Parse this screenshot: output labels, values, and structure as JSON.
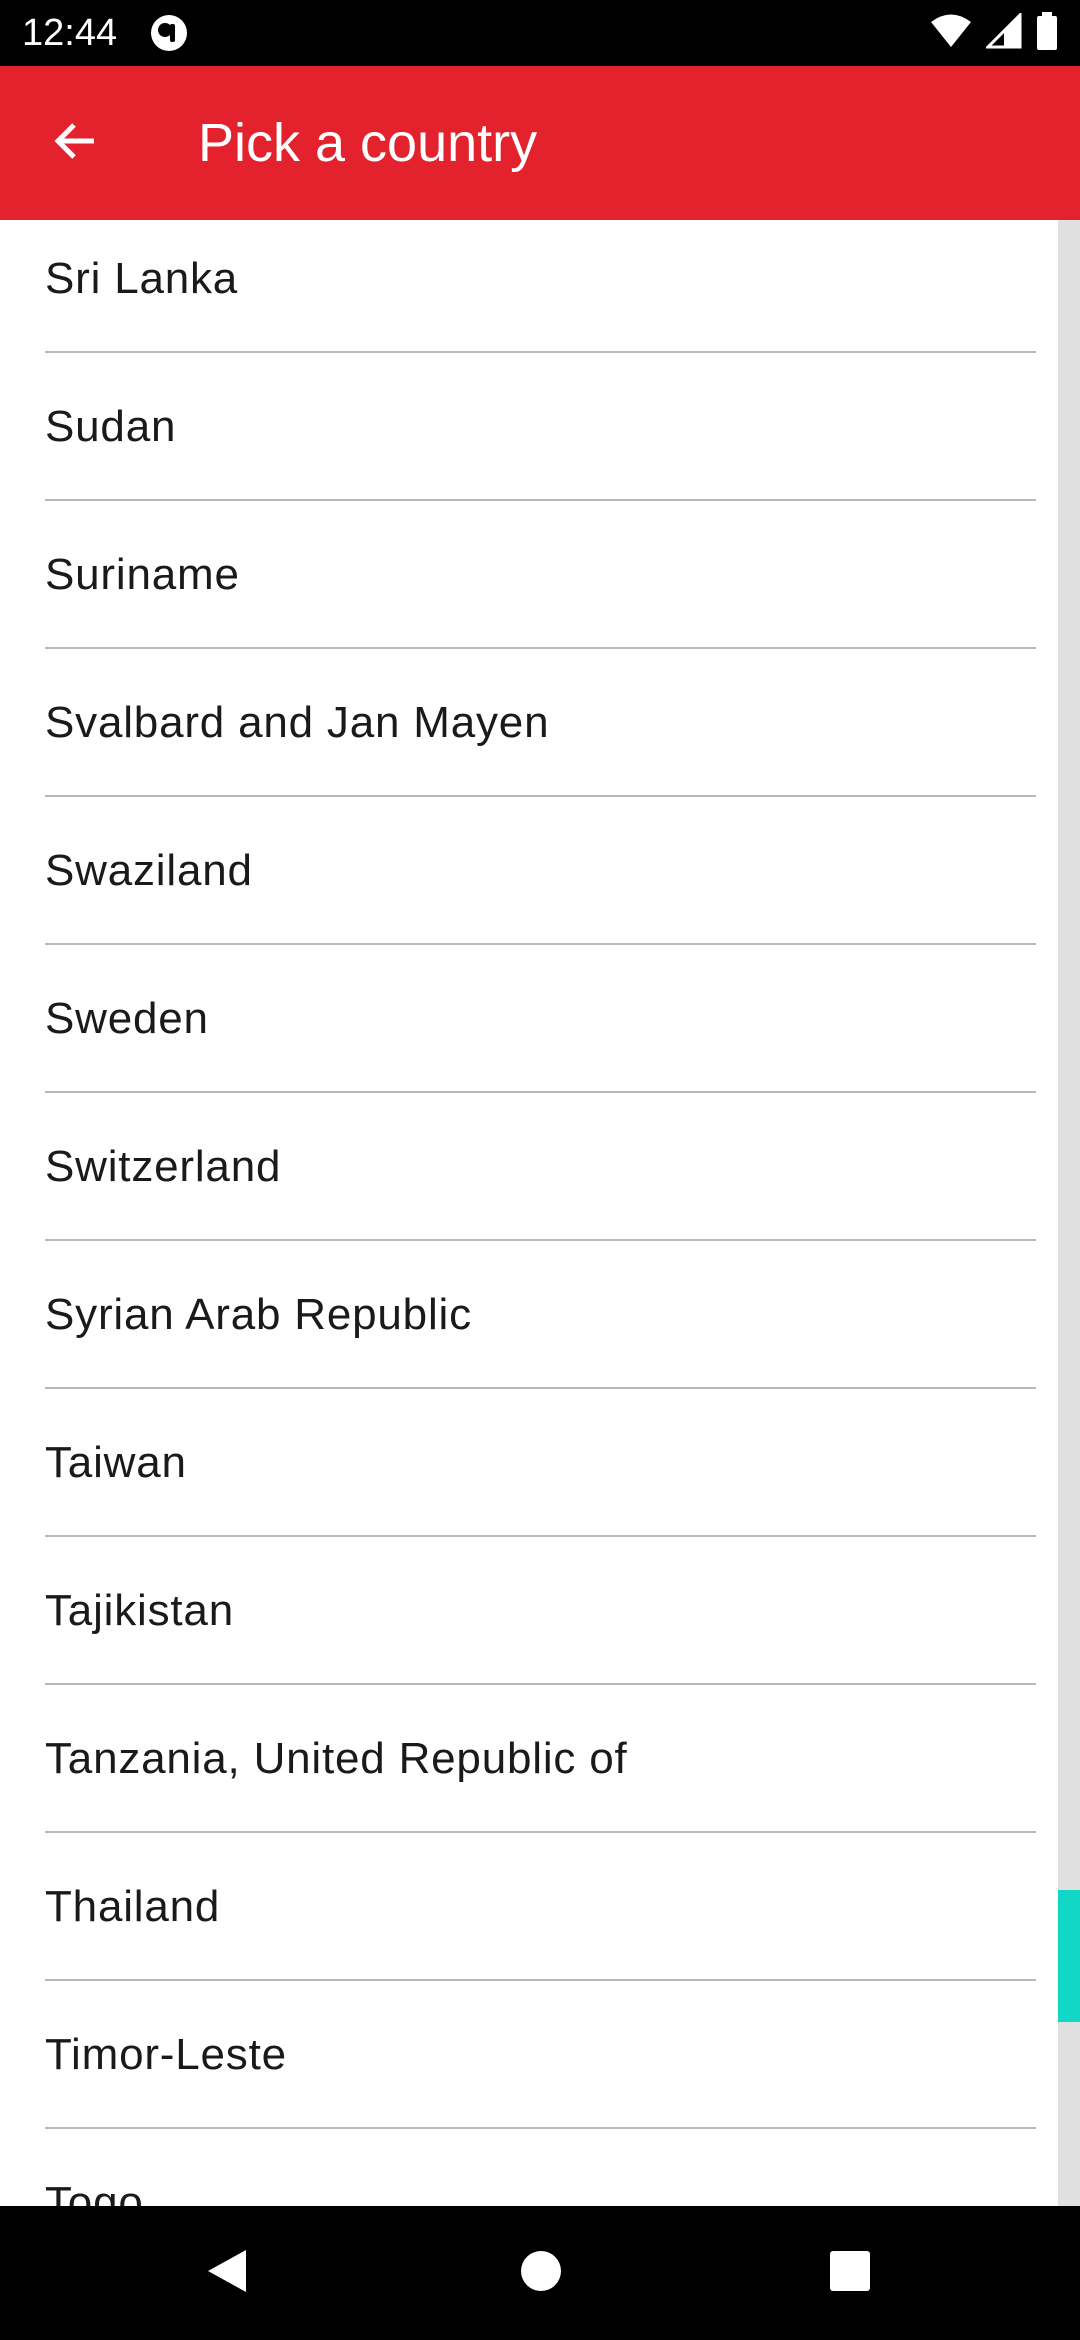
{
  "status_bar": {
    "time": "12:44",
    "icons": [
      "app-notification-icon",
      "wifi-icon",
      "signal-icon",
      "battery-icon"
    ]
  },
  "app_bar": {
    "title": "Pick a country",
    "back_icon": "arrow-back-icon",
    "background_color": "#e3222d"
  },
  "countries": [
    "Sri Lanka",
    "Sudan",
    "Suriname",
    "Svalbard and Jan Mayen",
    "Swaziland",
    "Sweden",
    "Switzerland",
    "Syrian Arab Republic",
    "Taiwan",
    "Tajikistan",
    "Tanzania, United Republic of",
    "Thailand",
    "Timor-Leste",
    "Togo"
  ],
  "scrollbar": {
    "thumb_color": "#11d8c6"
  },
  "nav_bar": {
    "icons": [
      "back-triangle-icon",
      "home-circle-icon",
      "recents-square-icon"
    ]
  }
}
